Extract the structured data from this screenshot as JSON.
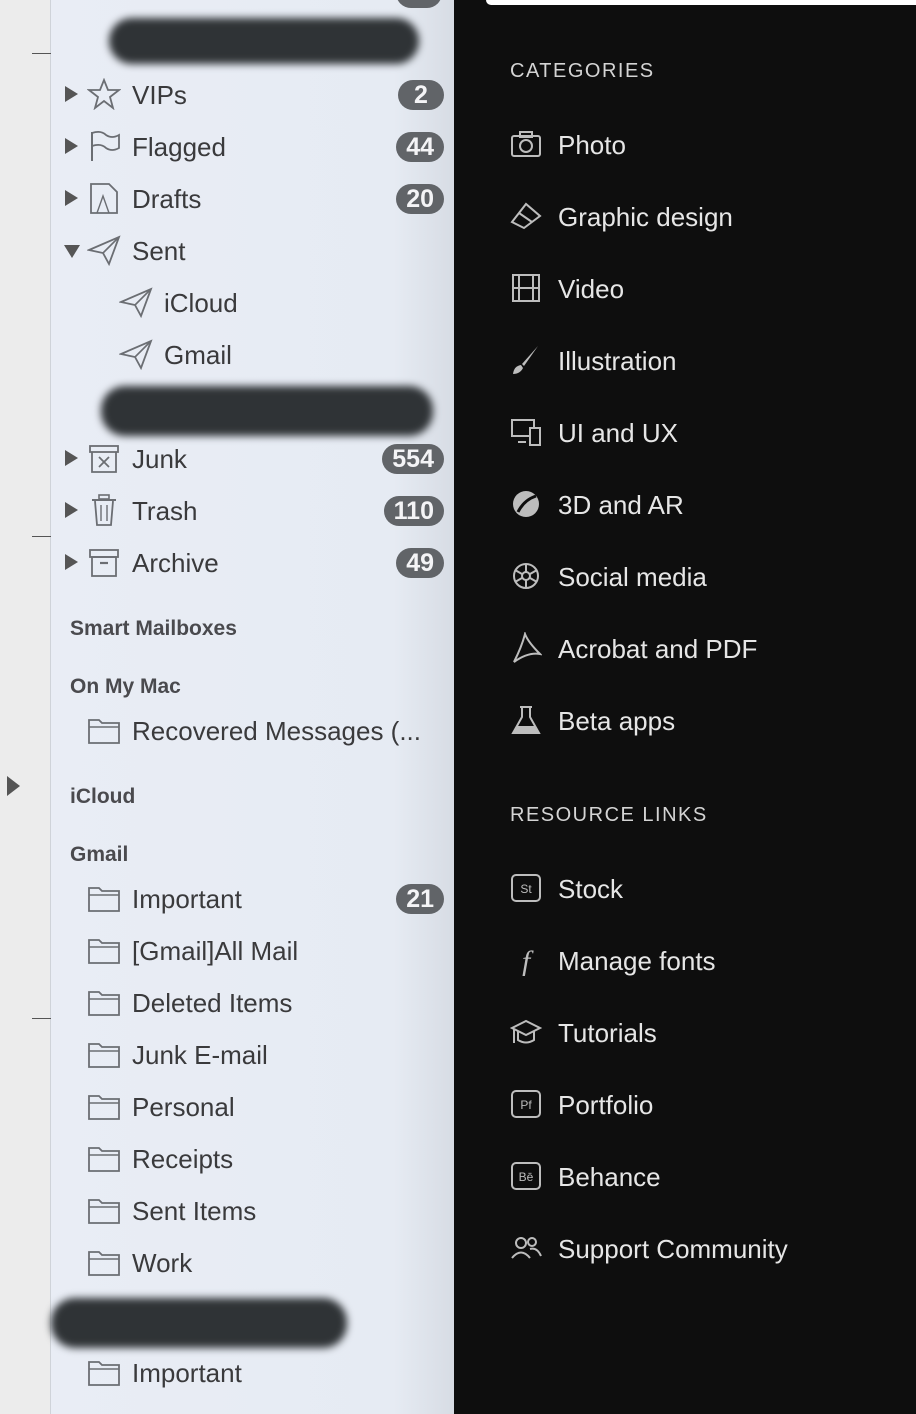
{
  "mail_sidebar": {
    "items": [
      {
        "label": "VIPs",
        "badge": "2",
        "icon": "star-icon"
      },
      {
        "label": "Flagged",
        "badge": "44",
        "icon": "flag-icon"
      },
      {
        "label": "Drafts",
        "badge": "20",
        "icon": "drafts-icon"
      },
      {
        "label": "Sent",
        "badge": "",
        "icon": "sent-icon"
      },
      {
        "label": "iCloud",
        "badge": "",
        "icon": "sent-icon"
      },
      {
        "label": "Gmail",
        "badge": "",
        "icon": "sent-icon"
      },
      {
        "label": "Junk",
        "badge": "554",
        "icon": "junk-icon"
      },
      {
        "label": "Trash",
        "badge": "110",
        "icon": "trash-icon"
      },
      {
        "label": "Archive",
        "badge": "49",
        "icon": "archive-icon"
      }
    ],
    "sections": {
      "smart_mailboxes": "Smart Mailboxes",
      "on_my_mac": "On My Mac",
      "icloud": "iCloud",
      "gmail": "Gmail"
    },
    "on_my_mac_items": [
      {
        "label": "Recovered Messages (..."
      }
    ],
    "gmail_items": [
      {
        "label": "Important",
        "badge": "21"
      },
      {
        "label": "[Gmail]All Mail",
        "badge": ""
      },
      {
        "label": "Deleted Items",
        "badge": ""
      },
      {
        "label": "Junk E-mail",
        "badge": ""
      },
      {
        "label": "Personal",
        "badge": ""
      },
      {
        "label": "Receipts",
        "badge": ""
      },
      {
        "label": "Sent Items",
        "badge": ""
      },
      {
        "label": "Work",
        "badge": ""
      }
    ],
    "bottom_items": [
      {
        "label": "Important"
      }
    ]
  },
  "categories": {
    "header": "CATEGORIES",
    "items": [
      {
        "label": "Photo",
        "icon": "camera-icon"
      },
      {
        "label": "Graphic design",
        "icon": "graphic-design-icon"
      },
      {
        "label": "Video",
        "icon": "film-icon"
      },
      {
        "label": "Illustration",
        "icon": "brush-icon"
      },
      {
        "label": "UI and UX",
        "icon": "devices-icon"
      },
      {
        "label": "3D and AR",
        "icon": "sphere-icon"
      },
      {
        "label": "Social media",
        "icon": "social-icon"
      },
      {
        "label": "Acrobat and PDF",
        "icon": "acrobat-icon"
      },
      {
        "label": "Beta apps",
        "icon": "flask-icon"
      }
    ]
  },
  "resource_links": {
    "header": "RESOURCE LINKS",
    "items": [
      {
        "label": "Stock",
        "icon": "stock-icon"
      },
      {
        "label": "Manage fonts",
        "icon": "font-icon"
      },
      {
        "label": "Tutorials",
        "icon": "graduation-cap-icon"
      },
      {
        "label": "Portfolio",
        "icon": "portfolio-icon"
      },
      {
        "label": "Behance",
        "icon": "behance-icon"
      },
      {
        "label": "Support Community",
        "icon": "community-icon"
      }
    ]
  }
}
